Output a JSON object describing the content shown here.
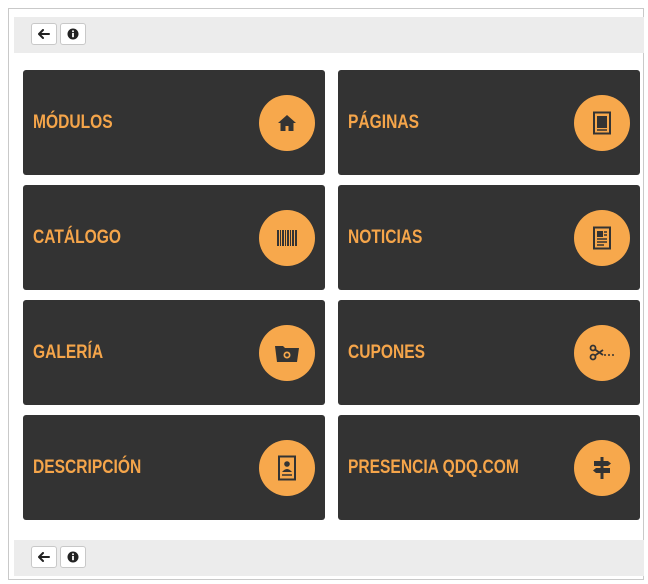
{
  "toolbar_top": {
    "back_icon": "arrow-left-icon",
    "info_icon": "info-circle-icon"
  },
  "toolbar_bottom": {
    "back_icon": "arrow-left-icon",
    "info_icon": "info-circle-icon"
  },
  "tiles": [
    {
      "label": "MÓDULOS",
      "icon": "home-icon"
    },
    {
      "label": "PÁGINAS",
      "icon": "page-icon"
    },
    {
      "label": "CATÁLOGO",
      "icon": "barcode-icon"
    },
    {
      "label": "NOTICIAS",
      "icon": "news-icon"
    },
    {
      "label": "GALERÍA",
      "icon": "camera-folder-icon"
    },
    {
      "label": "CUPONES",
      "icon": "scissors-icon"
    },
    {
      "label": "DESCRIPCIÓN",
      "icon": "profile-card-icon"
    },
    {
      "label": "PRESENCIA QDQ.COM",
      "icon": "signpost-icon"
    }
  ],
  "colors": {
    "tile_bg": "#333333",
    "accent": "#f7a84c",
    "label": "#f5a54a",
    "toolbar_bg": "#ececec"
  }
}
